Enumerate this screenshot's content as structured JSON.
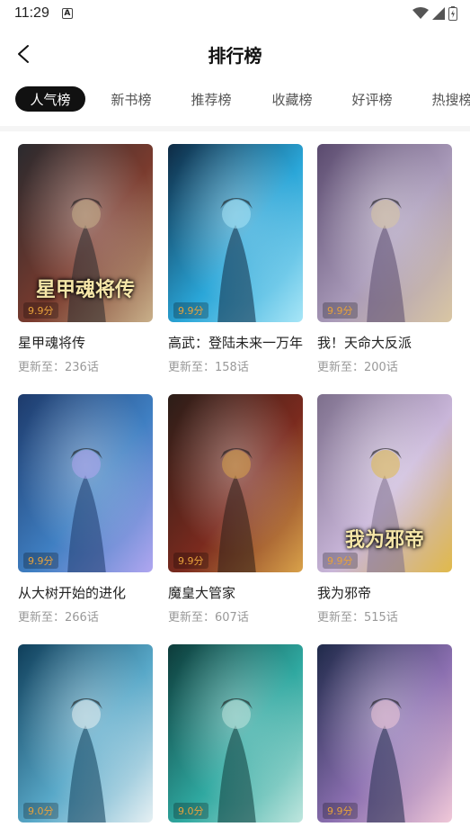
{
  "status": {
    "time": "11:29",
    "badge": "A"
  },
  "header": {
    "title": "排行榜"
  },
  "tabs": [
    {
      "label": "人气榜",
      "active": true
    },
    {
      "label": "新书榜",
      "active": false
    },
    {
      "label": "推荐榜",
      "active": false
    },
    {
      "label": "收藏榜",
      "active": false
    },
    {
      "label": "好评榜",
      "active": false
    },
    {
      "label": "热搜榜",
      "active": false
    }
  ],
  "comics": [
    {
      "title": "星甲魂将传",
      "update": "更新至：236话",
      "score": "9.9分",
      "cover_text": "星甲魂将传",
      "palette": [
        "#2a2a2e",
        "#7a3b2e",
        "#c9b08a"
      ]
    },
    {
      "title": "高武：登陆未来一万年",
      "update": "更新至：158话",
      "score": "9.9分",
      "cover_text": "",
      "palette": [
        "#0e2a44",
        "#2aa6d8",
        "#a8e6f7"
      ]
    },
    {
      "title": "我！天命大反派",
      "update": "更新至：200话",
      "score": "9.9分",
      "cover_text": "",
      "palette": [
        "#5a4a6e",
        "#a99ab9",
        "#d9c6a3"
      ]
    },
    {
      "title": "从大树开始的进化",
      "update": "更新至：266话",
      "score": "9.9分",
      "cover_text": "",
      "palette": [
        "#1d3a6b",
        "#3f7fc2",
        "#b0a6f0"
      ]
    },
    {
      "title": "魔皇大管家",
      "update": "更新至：607话",
      "score": "9.9分",
      "cover_text": "",
      "palette": [
        "#2b1d18",
        "#7a2a1e",
        "#d9a24a"
      ]
    },
    {
      "title": "我为邪帝",
      "update": "更新至：515话",
      "score": "9.9分",
      "cover_text": "我为邪帝",
      "palette": [
        "#7d6f8c",
        "#c9b6d9",
        "#e0b94a"
      ]
    },
    {
      "title": "",
      "update": "",
      "score": "9.0分",
      "cover_text": "",
      "palette": [
        "#0f3e5a",
        "#58a8c8",
        "#e6f0f3"
      ]
    },
    {
      "title": "",
      "update": "",
      "score": "9.0分",
      "cover_text": "",
      "palette": [
        "#0d3b3a",
        "#2fa8a0",
        "#bfe6de"
      ]
    },
    {
      "title": "",
      "update": "",
      "score": "9.9分",
      "cover_text": "",
      "palette": [
        "#1f2a4a",
        "#8b6fb0",
        "#f0c8d8"
      ]
    }
  ]
}
